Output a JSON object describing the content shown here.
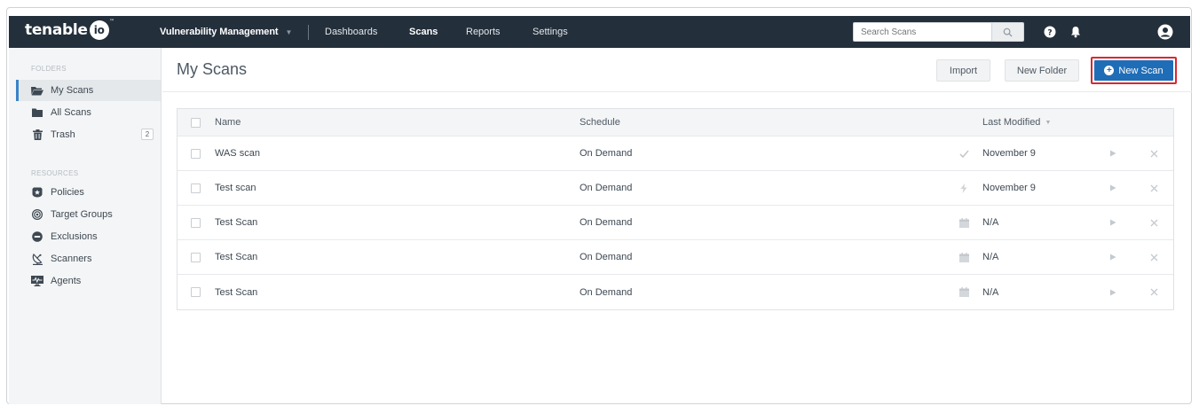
{
  "app": {
    "logo_text": "tenable",
    "logo_badge": "io",
    "logo_tm": "™"
  },
  "nav": {
    "product": "Vulnerability Management",
    "links": [
      "Dashboards",
      "Scans",
      "Reports",
      "Settings"
    ],
    "active": "Scans",
    "search_placeholder": "Search Scans",
    "icons": [
      "search-icon",
      "help-icon",
      "bell-icon",
      "user-icon"
    ]
  },
  "sidebar": {
    "folders_heading": "FOLDERS",
    "folders": [
      {
        "label": "My Scans",
        "icon": "folder-open-icon",
        "active": true
      },
      {
        "label": "All Scans",
        "icon": "folder-icon"
      },
      {
        "label": "Trash",
        "icon": "trash-icon",
        "badge": "2"
      }
    ],
    "resources_heading": "RESOURCES",
    "resources": [
      {
        "label": "Policies",
        "icon": "shield-icon"
      },
      {
        "label": "Target Groups",
        "icon": "target-icon"
      },
      {
        "label": "Exclusions",
        "icon": "minus-circle-icon"
      },
      {
        "label": "Scanners",
        "icon": "satellite-dish-icon"
      },
      {
        "label": "Agents",
        "icon": "monitor-pulse-icon"
      }
    ]
  },
  "main": {
    "title": "My Scans",
    "buttons": {
      "import": "Import",
      "new_folder": "New Folder",
      "new_scan": "New Scan"
    },
    "table": {
      "headers": {
        "name": "Name",
        "schedule": "Schedule",
        "last_modified": "Last Modified"
      },
      "rows": [
        {
          "name": "WAS scan",
          "schedule": "On Demand",
          "status_icon": "check-icon",
          "last_modified": "November 9"
        },
        {
          "name": "Test scan",
          "schedule": "On Demand",
          "status_icon": "bolt-icon",
          "last_modified": "November 9"
        },
        {
          "name": "Test Scan",
          "schedule": "On Demand",
          "status_icon": "calendar-icon",
          "last_modified": "N/A"
        },
        {
          "name": "Test Scan",
          "schedule": "On Demand",
          "status_icon": "calendar-icon",
          "last_modified": "N/A"
        },
        {
          "name": "Test Scan",
          "schedule": "On Demand",
          "status_icon": "calendar-icon",
          "last_modified": "N/A"
        }
      ]
    }
  },
  "colors": {
    "nav_bg": "#232f3b",
    "primary": "#1f6db6",
    "highlight": "#d9282f",
    "active_accent": "#3b83c8"
  }
}
